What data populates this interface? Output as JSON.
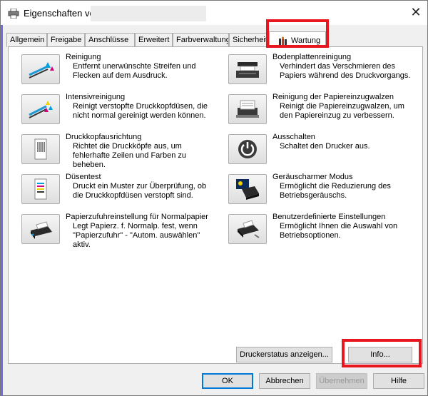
{
  "window": {
    "title": "Eigenschaften von",
    "close_glyph": "✕"
  },
  "tabs": [
    {
      "label": "Allgemein"
    },
    {
      "label": "Freigabe"
    },
    {
      "label": "Anschlüsse"
    },
    {
      "label": "Erweitert"
    },
    {
      "label": "Farbverwaltung"
    },
    {
      "label": "Sicherheit"
    },
    {
      "label": "Wartung",
      "active": true,
      "icon": "maintenance-icon"
    }
  ],
  "left_items": [
    {
      "title": "Reinigung",
      "desc": "Entfernt unerwünschte Streifen und Flecken auf dem Ausdruck.",
      "icon": "cleaning-icon"
    },
    {
      "title": "Intensivreinigung",
      "desc": "Reinigt verstopfte Druckkopfdüsen, die nicht normal gereinigt werden können.",
      "icon": "deep-cleaning-icon"
    },
    {
      "title": "Druckkopfausrichtung",
      "desc": "Richtet die Druckköpfe aus, um fehlerhafte Zeilen und Farben zu beheben.",
      "icon": "print-head-alignment-icon"
    },
    {
      "title": "Düsentest",
      "desc": "Druckt ein Muster zur Überprüfung, ob die Druckkopfdüsen verstopft sind.",
      "icon": "nozzle-check-icon"
    },
    {
      "title": "Papierzufuhreinstellung für Normalpapier",
      "desc": "Legt Papierz. f. Normalp. fest, wenn \"Papierzufuhr\" - \"Autom. auswählen\" aktiv.",
      "icon": "paper-feed-icon"
    }
  ],
  "right_items": [
    {
      "title": "Bodenplattenreinigung",
      "desc": "Verhindert das Verschmieren des Papiers während des Druckvorgangs.",
      "icon": "bottom-plate-cleaning-icon"
    },
    {
      "title": "Reinigung der Papiereinzugwalzen",
      "desc": "Reinigt die Papiereinzugwalzen, um den Papiereinzug zu verbessern.",
      "icon": "roller-cleaning-icon"
    },
    {
      "title": "Ausschalten",
      "desc": "Schaltet den Drucker aus.",
      "icon": "power-icon"
    },
    {
      "title": "Geräuscharmer Modus",
      "desc": "Ermöglicht die Reduzierung des Betriebsgeräuschs.",
      "icon": "quiet-mode-icon"
    },
    {
      "title": "Benutzerdefinierte Einstellungen",
      "desc": "Ermöglicht Ihnen die Auswahl von Betriebsoptionen.",
      "icon": "custom-settings-icon"
    }
  ],
  "panel_buttons": {
    "status": "Druckerstatus anzeigen...",
    "info": "Info..."
  },
  "dialog_buttons": {
    "ok": "OK",
    "cancel": "Abbrechen",
    "apply": "Übernehmen",
    "help": "Hilfe"
  },
  "colors": {
    "highlight": "#e8171f",
    "default_button_border": "#0078d7"
  }
}
